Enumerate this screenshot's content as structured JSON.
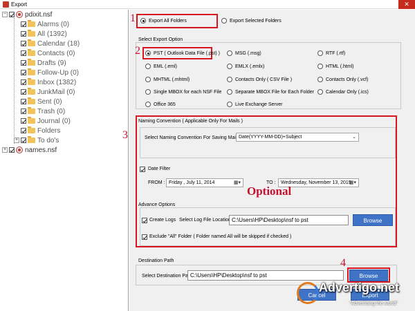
{
  "window": {
    "title": "Export",
    "close_glyph": "✕"
  },
  "tree": {
    "root1": "pdixit.nsf",
    "items": [
      "Alarms (0)",
      "All (1392)",
      "Calendar (18)",
      "Contacts (0)",
      "Drafts (9)",
      "Follow-Up (0)",
      "Inbox (1382)",
      "JunkMail (0)",
      "Sent (0)",
      "Trash (0)",
      "Journal (0)",
      "Folders",
      "To do's"
    ],
    "root2": "names.nsf",
    "expand_glyph": "−",
    "collapsed_glyph": "+"
  },
  "annotations": {
    "n1": "1",
    "n2": "2",
    "n3": "3",
    "n4": "4",
    "optional": "Optional"
  },
  "folder_scope": {
    "export_all": "Export All Folders",
    "export_selected": "Export Selected Folders",
    "selected": "export_all"
  },
  "export_options": {
    "title": "Select Export Option",
    "items": [
      "PST ( Outlook Data File (.pst) )",
      "MSG (.msg)",
      "RTF (.rtf)",
      "EML (.eml)",
      "EMLX (.emlx)",
      "HTML (.html)",
      "MHTML (.mhtml)",
      "Contacts Only ( CSV File )",
      "Contacts Only (.vcf)",
      "Single MBOX for each NSF File",
      "Separate MBOX File for Each Folder",
      "Calendar Only (.ics)",
      "Office 365",
      "Live Exchange Server"
    ],
    "selected": "PST ( Outlook Data File (.pst) )"
  },
  "naming": {
    "title": "Naming Convention ( Applicable Only For Mails )",
    "label": "Select Naming Convention For Saving Mails",
    "value": "Date(YYYY-MM-DD)+Subject"
  },
  "date_filter": {
    "label": "Date Filter",
    "from_label": "FROM :",
    "from_value": "Friday  ,   July    11, 2014",
    "to_label": "TO :",
    "to_value": "Wednesday, November 13, 2019"
  },
  "advance": {
    "title": "Advance Options",
    "create_logs": "Create Logs",
    "log_label": "Select Log File Location :",
    "log_value": "C:\\Users\\HP\\Desktop\\nsf to pst",
    "browse": "Browse",
    "exclude_all": "Exclude \"All\" Folder ( Folder named All will be skipped if checked )"
  },
  "destination": {
    "title": "Destination Path",
    "label": "Select Destination Path",
    "value": "C:\\Users\\HP\\Desktop\\nsf to pst",
    "browse": "Browse"
  },
  "footer": {
    "cancel": "Cancel",
    "export": "Export"
  },
  "watermark": {
    "text": "Advertigo.net",
    "tagline": "\"Advertising the world\""
  },
  "colors": {
    "annotation_red": "#d9161f",
    "button_blue": "#3f73c6",
    "folder_yellow": "#f2c25b"
  }
}
